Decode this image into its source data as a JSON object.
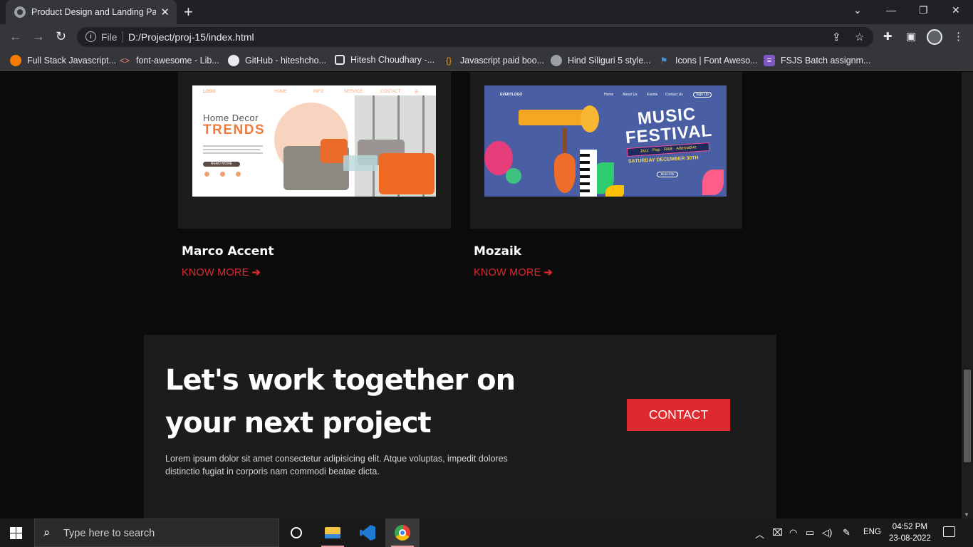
{
  "browser": {
    "tab_title": "Product Design and Landing Pag",
    "tab_close": "✕",
    "new_tab": "+",
    "window_controls": {
      "minimize": "—",
      "maximize": "❐",
      "close": "✕",
      "tab_search": "⌄"
    },
    "omnibox": {
      "scheme_label": "File",
      "url": "D:/Project/proj-15/index.html"
    },
    "bookmarks": [
      {
        "label": "Full Stack Javascript...",
        "icon": "orange-circle-icon"
      },
      {
        "label": "font-awesome - Lib...",
        "icon": "code-brackets-icon"
      },
      {
        "label": "GitHub - hiteshcho...",
        "icon": "github-icon"
      },
      {
        "label": "Hitesh Choudhary -...",
        "icon": "square-icon"
      },
      {
        "label": "Javascript paid boo...",
        "icon": "braces-icon"
      },
      {
        "label": "Hind Siliguri 5 style...",
        "icon": "globe-icon"
      },
      {
        "label": "Icons | Font Aweso...",
        "icon": "flag-icon"
      },
      {
        "label": "FSJS Batch assignm...",
        "icon": "list-icon"
      }
    ]
  },
  "page": {
    "projects": [
      {
        "title": "Marco Accent",
        "link": "KNOW MORE",
        "thumbnail": {
          "logo": "LOGO",
          "nav": [
            "HOME",
            "INFO",
            "SERVICE",
            "CONTACT"
          ],
          "heading": "Home  Decor",
          "subheading": "TRENDS",
          "button": "READ MORE"
        }
      },
      {
        "title": "Mozaik",
        "link": "KNOW MORE",
        "thumbnail": {
          "logo": "EVENTLOGO",
          "nav": [
            "Home",
            "About Us",
            "Events",
            "Contact Us",
            "Sign Up"
          ],
          "heading_1": "MUSIC",
          "heading_2": "FESTIVAL",
          "genres": "Jazz · Pop · R&B · Alternative",
          "date": "SATURDAY DECEMBER 30TH",
          "button": "More info"
        }
      }
    ],
    "cta": {
      "title_line1": "Let's work together on",
      "title_line2": "your next project",
      "body": "Lorem ipsum dolor sit amet consectetur adipisicing elit. Atque voluptas, impedit dolores distinctio fugiat in corporis nam commodi beatae dicta.",
      "button": "CONTACT"
    },
    "accent_color": "#dd2a2f"
  },
  "taskbar": {
    "search_placeholder": "Type here to search",
    "language": "ENG",
    "time": "04:52 PM",
    "date": "23-08-2022",
    "tray_icons": [
      "chevron-up-icon",
      "meet-now-icon",
      "wifi-icon",
      "battery-icon",
      "volume-icon",
      "pen-icon"
    ]
  }
}
